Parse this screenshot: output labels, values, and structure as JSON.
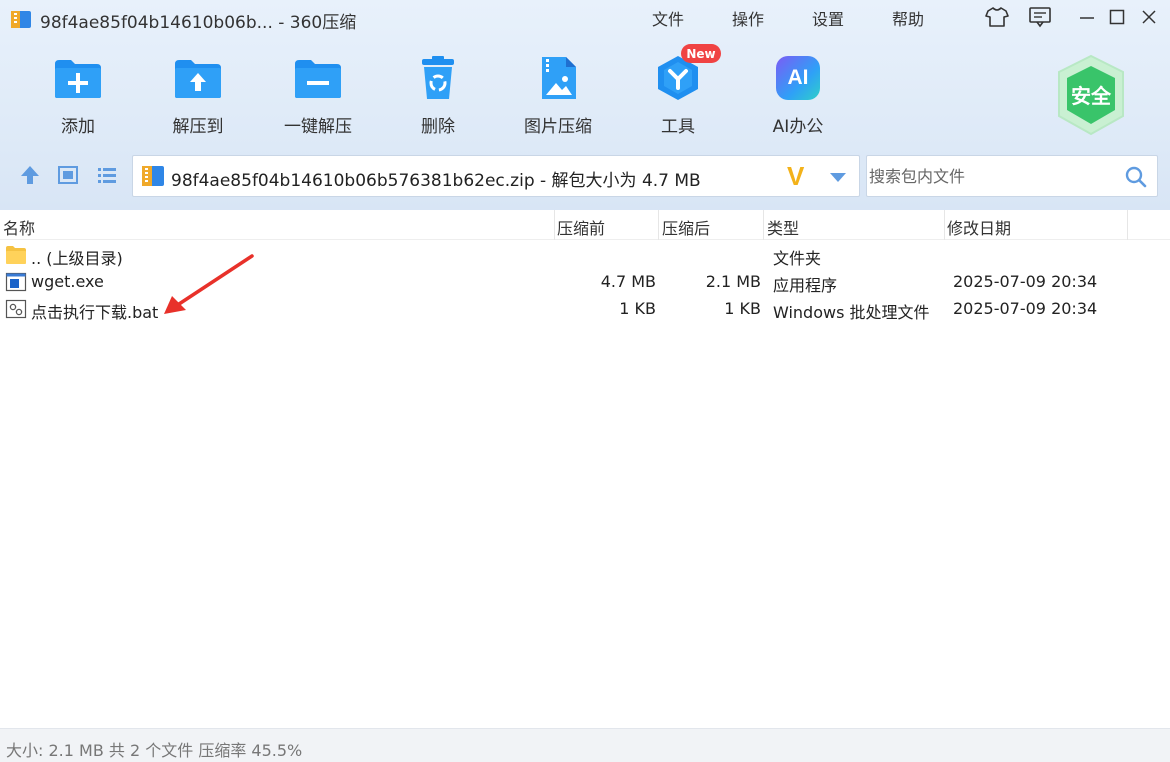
{
  "window": {
    "title": "98f4ae85f04b14610b06b... - 360压缩",
    "app_icon": "archive-app-icon"
  },
  "menu": {
    "file": "文件",
    "operate": "操作",
    "settings": "设置",
    "help": "帮助"
  },
  "toolbar": {
    "add": "添加",
    "extract_to": "解压到",
    "one_click_extract": "一键解压",
    "delete": "删除",
    "image_compress": "图片压缩",
    "tools": "工具",
    "tools_badge": "New",
    "ai_office": "AI办公",
    "ai_icon_text": "AI",
    "safe": "安全"
  },
  "address": {
    "path": "98f4ae85f04b14610b06b576381b62ec.zip - 解包大小为 4.7 MB",
    "v_badge": "V"
  },
  "search": {
    "placeholder": "搜索包内文件"
  },
  "columns": {
    "name": "名称",
    "compressed": "压缩前",
    "after": "压缩后",
    "type": "类型",
    "modified": "修改日期"
  },
  "files": [
    {
      "name": ".. (上级目录)",
      "size": "",
      "packed": "",
      "type": "文件夹",
      "date": "",
      "icon": "folder-icon"
    },
    {
      "name": "wget.exe",
      "size": "4.7 MB",
      "packed": "2.1 MB",
      "type": "应用程序",
      "date": "2025-07-09 20:34",
      "icon": "exe-icon"
    },
    {
      "name": "点击执行下载.bat",
      "size": "1 KB",
      "packed": "1 KB",
      "type": "Windows 批处理文件",
      "date": "2025-07-09 20:34",
      "icon": "bat-icon"
    }
  ],
  "status": {
    "text": "大小: 2.1 MB 共 2 个文件 压缩率 45.5%"
  },
  "colors": {
    "accent": "#1f8ff0",
    "chrome_bg": "#dde9f7",
    "arrow": "#e8312a",
    "safe_green": "#39c46a"
  }
}
